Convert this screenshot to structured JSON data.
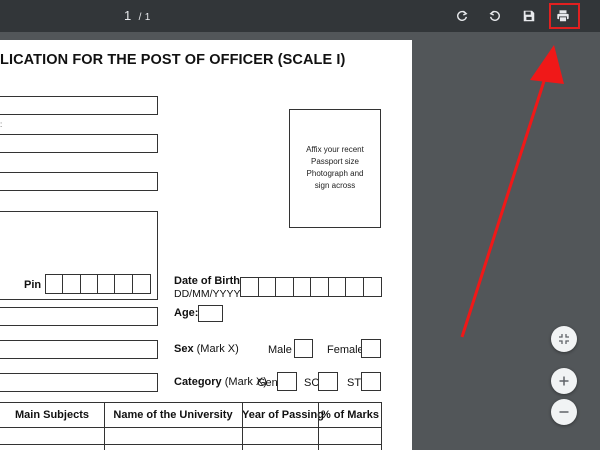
{
  "toolbar": {
    "current_page": "1",
    "page_separator": "/",
    "total_pages": "1",
    "icons": [
      "rotate-clockwise-icon",
      "rotate-counterclockwise-icon",
      "save-icon",
      "print-icon"
    ]
  },
  "form": {
    "title": "LICATION FOR THE POST OF OFFICER (SCALE I)",
    "stray_mark": ":",
    "photo_text": "Affix your recent Passport size Photograph and sign across",
    "pin_label": "Pin",
    "dob_label": "Date of Birth",
    "dob_format": "DD/MM/YYYY",
    "age_label": "Age:",
    "sex_label": "Sex",
    "sex_hint": "(Mark X)",
    "male_label": "Male",
    "female_label": "Female",
    "category_label": "Category",
    "category_hint": "(Mark X)",
    "gen_label": "Gen",
    "sc_label": "SC",
    "st_label": "ST"
  },
  "table": {
    "headers": [
      "Main Subjects",
      "Name of the University",
      "Year of Passing",
      "% of Marks"
    ]
  },
  "zoom": {
    "icons": [
      "fit-page-icon",
      "zoom-in-icon",
      "zoom-out-icon"
    ]
  },
  "colors": {
    "toolbar_bg": "#323639",
    "viewer_bg": "#525659",
    "highlight": "#e02020"
  }
}
